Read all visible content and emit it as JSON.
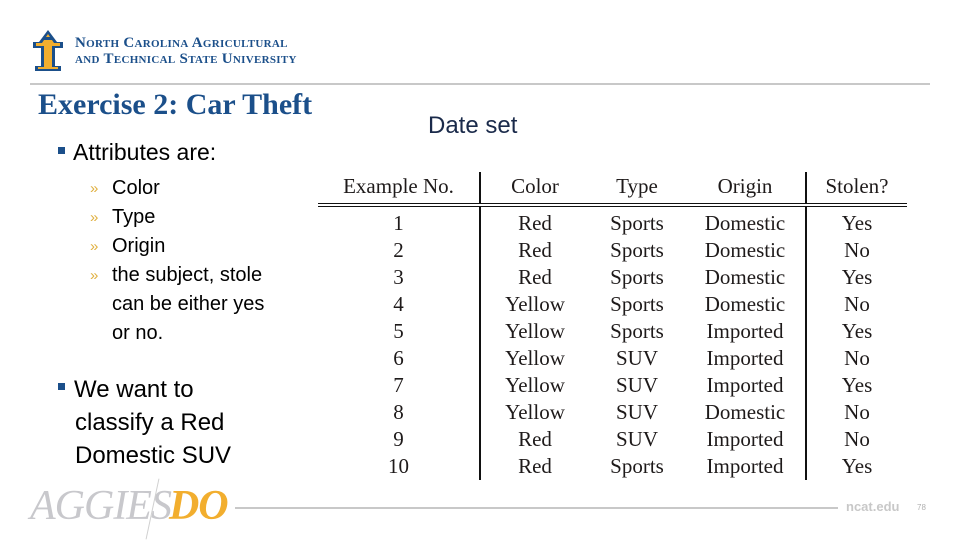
{
  "header": {
    "university_line1": "North Carolina Agricultural",
    "university_line2": "and Technical State University",
    "logo_icon": "ncat-aggie-logo-icon"
  },
  "slide": {
    "title": "Exercise 2: Car Theft",
    "dataset_label": "Date set",
    "bullets": [
      {
        "text": "Attributes are:"
      }
    ],
    "sub_bullets": [
      {
        "text": "Color"
      },
      {
        "text": "Type"
      },
      {
        "text": "Origin"
      },
      {
        "lines": [
          "the subject, stole",
          "can be either yes",
          "or no."
        ]
      }
    ],
    "goal_lines": [
      "We want to",
      "classify a Red",
      "Domestic SUV"
    ]
  },
  "table": {
    "headers": [
      "Example No.",
      "Color",
      "Type",
      "Origin",
      "Stolen?"
    ],
    "rows": [
      [
        "1",
        "Red",
        "Sports",
        "Domestic",
        "Yes"
      ],
      [
        "2",
        "Red",
        "Sports",
        "Domestic",
        "No"
      ],
      [
        "3",
        "Red",
        "Sports",
        "Domestic",
        "Yes"
      ],
      [
        "4",
        "Yellow",
        "Sports",
        "Domestic",
        "No"
      ],
      [
        "5",
        "Yellow",
        "Sports",
        "Imported",
        "Yes"
      ],
      [
        "6",
        "Yellow",
        "SUV",
        "Imported",
        "No"
      ],
      [
        "7",
        "Yellow",
        "SUV",
        "Imported",
        "Yes"
      ],
      [
        "8",
        "Yellow",
        "SUV",
        "Domestic",
        "No"
      ],
      [
        "9",
        "Red",
        "SUV",
        "Imported",
        "No"
      ],
      [
        "10",
        "Red",
        "Sports",
        "Imported",
        "Yes"
      ]
    ]
  },
  "footer": {
    "brand_left": "AGGIES",
    "brand_right": "DO",
    "url": "ncat.edu",
    "page_number": "78"
  },
  "colors": {
    "brand_blue": "#1b4f8a",
    "brand_gold": "#f2ae2e",
    "rule_gray": "#c8c8c8"
  }
}
